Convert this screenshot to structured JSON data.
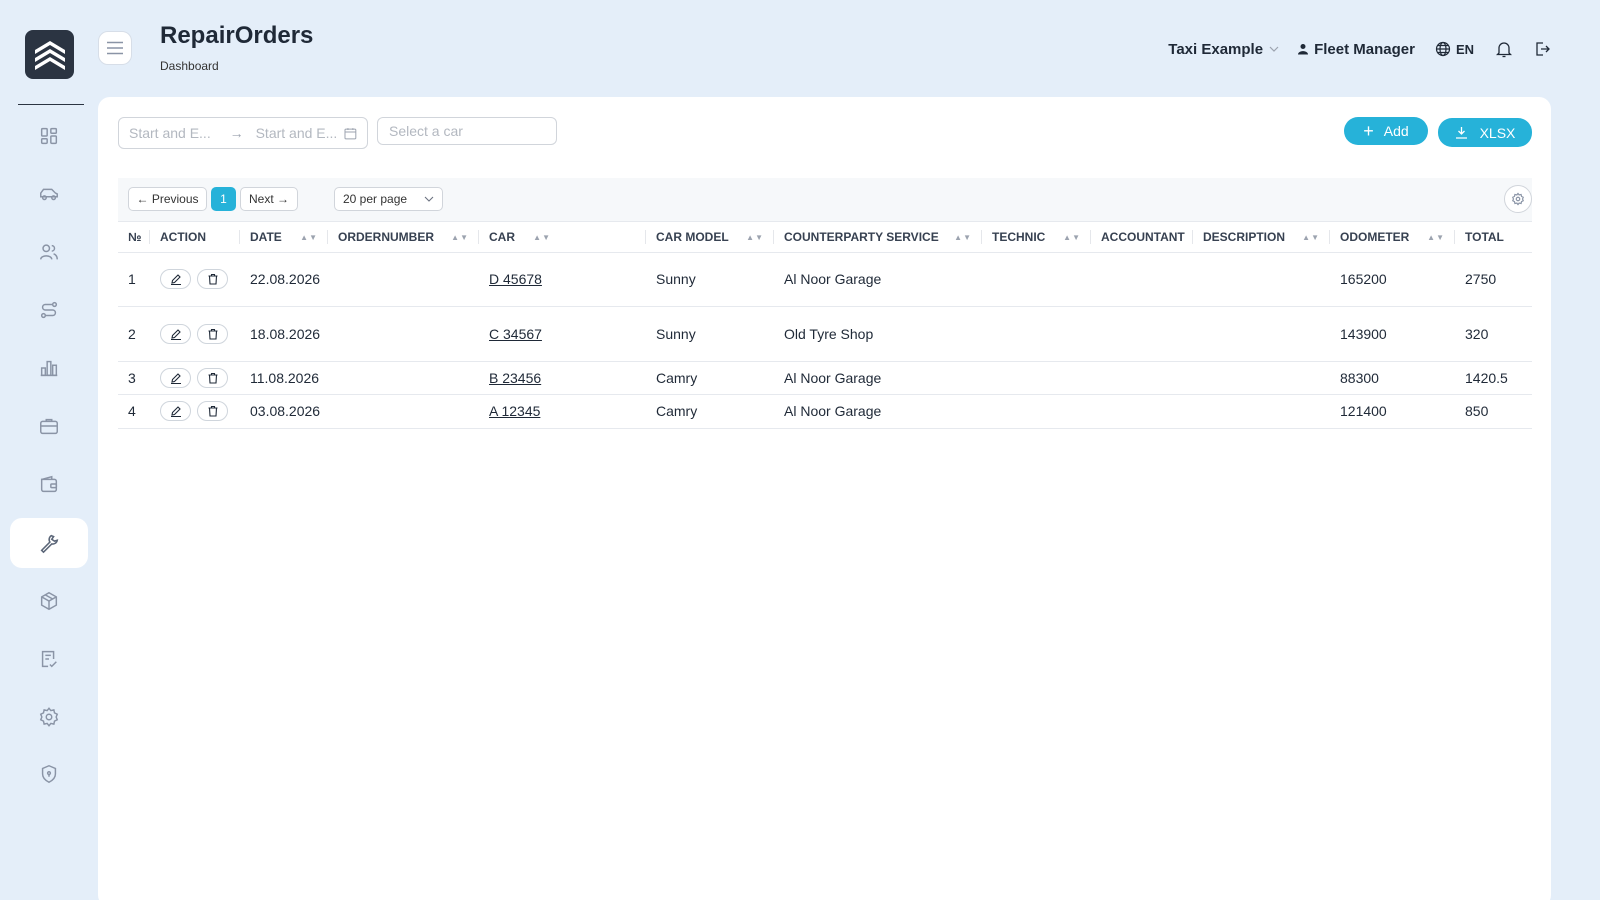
{
  "header": {
    "title": "RepairOrders",
    "breadcrumb": "Dashboard",
    "organization": "Taxi Example",
    "user": "Fleet Manager",
    "language": "EN"
  },
  "sidebar": {
    "items": [
      {
        "icon": "dashboard-icon"
      },
      {
        "icon": "car-icon"
      },
      {
        "icon": "users-icon"
      },
      {
        "icon": "route-icon"
      },
      {
        "icon": "chart-icon"
      },
      {
        "icon": "briefcase-icon"
      },
      {
        "icon": "wallet-icon"
      },
      {
        "icon": "wrench-icon",
        "active": true
      },
      {
        "icon": "box-icon"
      },
      {
        "icon": "checklist-icon"
      },
      {
        "icon": "gear-icon"
      },
      {
        "icon": "shield-icon"
      }
    ]
  },
  "filters": {
    "date_start_placeholder": "Start and E...",
    "date_end_placeholder": "Start and E...",
    "car_placeholder": "Select a car"
  },
  "actions": {
    "add_label": "Add",
    "xlsx_label": "XLSX"
  },
  "pagination": {
    "previous": "← Previous",
    "current_page": "1",
    "next": "Next →",
    "per_page": "20 per page"
  },
  "table": {
    "columns": [
      "№",
      "ACTION",
      "DATE",
      "ORDERNUMBER",
      "CAR",
      "CAR MODEL",
      "COUNTERPARTY SERVICE",
      "TECHNIC",
      "ACCOUNTANT",
      "DESCRIPTION",
      "ODOMETER",
      "TOTAL"
    ],
    "rows": [
      {
        "no": "1",
        "date": "22.08.2026",
        "ordernumber": "",
        "car": "D 45678",
        "car_model": "Sunny",
        "counterparty": "Al Noor Garage",
        "technic": "",
        "accountant": "",
        "description": "",
        "odometer": "165200",
        "total": "2750"
      },
      {
        "no": "2",
        "date": "18.08.2026",
        "ordernumber": "",
        "car": "C 34567",
        "car_model": "Sunny",
        "counterparty": "Old Tyre Shop",
        "technic": "",
        "accountant": "",
        "description": "",
        "odometer": "143900",
        "total": "320"
      },
      {
        "no": "3",
        "date": "11.08.2026",
        "ordernumber": "",
        "car": "B 23456",
        "car_model": "Camry",
        "counterparty": "Al Noor Garage",
        "technic": "",
        "accountant": "",
        "description": "",
        "odometer": "88300",
        "total": "1420.5"
      },
      {
        "no": "4",
        "date": "03.08.2026",
        "ordernumber": "",
        "car": "A 12345",
        "car_model": "Camry",
        "counterparty": "Al Noor Garage",
        "technic": "",
        "accountant": "",
        "description": "",
        "odometer": "121400",
        "total": "850"
      }
    ]
  },
  "colors": {
    "accent": "#26b2d9",
    "background": "#e4eef9",
    "dark": "#2b3442"
  }
}
